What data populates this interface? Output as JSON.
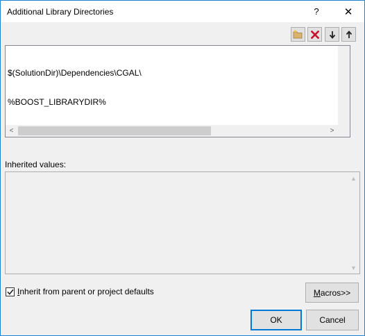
{
  "window": {
    "title": "Additional Library Directories",
    "help_glyph": "?",
    "close_glyph": "✕"
  },
  "toolbar": {
    "buttons": [
      {
        "name": "new-line",
        "icon": "folder-new-icon"
      },
      {
        "name": "delete",
        "icon": "delete-x-icon"
      },
      {
        "name": "move-down",
        "icon": "arrow-down-icon"
      },
      {
        "name": "move-up",
        "icon": "arrow-up-icon"
      }
    ]
  },
  "editor": {
    "lines": [
      "$(SolutionDir)\\Dependencies\\CGAL\\",
      "%BOOST_LIBRARYDIR%"
    ],
    "scroll_left": "<",
    "scroll_right": ">"
  },
  "inherited": {
    "label": "Inherited values:",
    "scroll_up": "▲",
    "scroll_down": "▼"
  },
  "inherit_checkbox": {
    "checked": true,
    "label_prefix": "",
    "label_accel": "I",
    "label_rest": "nherit from parent or project defaults"
  },
  "buttons": {
    "macros_accel": "M",
    "macros_rest": "acros>>",
    "ok": "OK",
    "cancel": "Cancel"
  },
  "colors": {
    "window_border": "#1883d7",
    "delete_red": "#c8102e",
    "folder_yellow": "#dcb36c"
  }
}
